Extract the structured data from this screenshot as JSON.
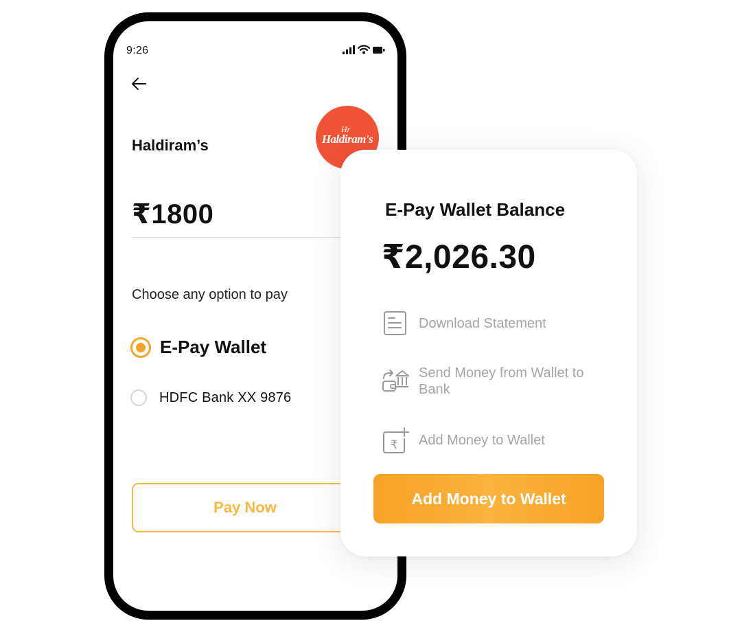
{
  "status_bar": {
    "time": "9:26",
    "icons": [
      "signal-icon",
      "wifi-icon",
      "battery-icon"
    ]
  },
  "payment_screen": {
    "back_icon": "back-arrow-icon",
    "merchant_name": "Haldiram’s",
    "merchant_logo_text": "Haldiram's",
    "amount": "₹1800",
    "prompt": "Choose any option to pay",
    "options": [
      {
        "label": "E-Pay Wallet",
        "selected": true
      },
      {
        "label": "HDFC Bank XX 9876",
        "selected": false
      }
    ],
    "pay_button_label": "Pay Now"
  },
  "wallet_card": {
    "title": "E-Pay Wallet Balance",
    "balance": "₹2,026.30",
    "actions": [
      {
        "label": "Download Statement",
        "icon": "statement-icon"
      },
      {
        "label": "Send Money from Wallet to Bank",
        "icon": "wallet-to-bank-icon"
      },
      {
        "label": "Add Money to Wallet",
        "icon": "add-rupee-icon"
      }
    ],
    "primary_button_label": "Add Money to Wallet"
  },
  "colors": {
    "accent": "#f8a428",
    "logo_red": "#f05236",
    "muted_text": "#a5a5a5"
  }
}
